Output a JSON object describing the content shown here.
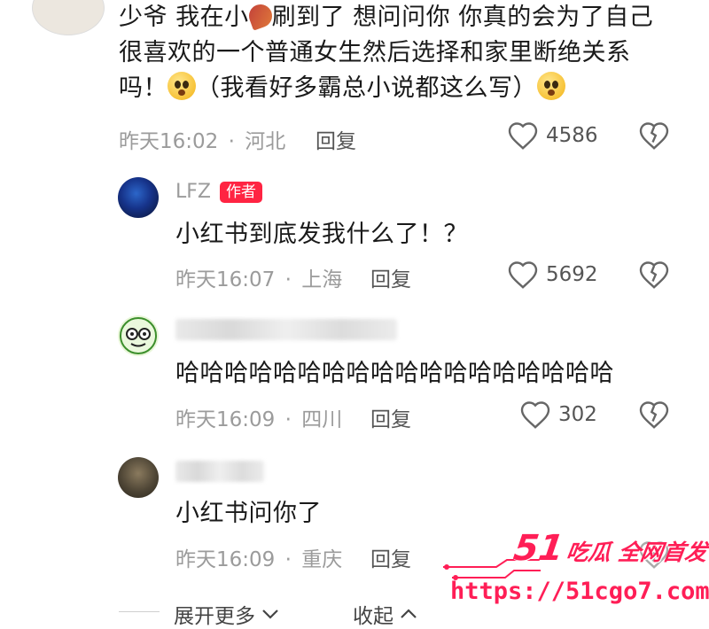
{
  "top_comment": {
    "text_line1": "少爷 我在小",
    "text_line1b": "刷到了 想问问你 你真的会为了自己",
    "text_line2": "很喜欢的一个普通女生然后选择和家里断绝关系",
    "text_line3a": "吗！",
    "text_line3b": "（我看好多霸总小说都这么写）",
    "time": "昨天16:02",
    "location": "河北",
    "reply_label": "回复",
    "likes": "4586"
  },
  "replies": [
    {
      "name": "LFZ",
      "tag": "作者",
      "text": "小红书到底发我什么了！？",
      "time": "昨天16:07",
      "location": "上海",
      "reply_label": "回复",
      "likes": "5692"
    },
    {
      "name": "",
      "text": "哈哈哈哈哈哈哈哈哈哈哈哈哈哈哈哈哈哈",
      "time": "昨天16:09",
      "location": "四川",
      "reply_label": "回复",
      "likes": "302"
    },
    {
      "name": "",
      "text": "小红书问你了",
      "time": "昨天16:09",
      "location": "重庆",
      "reply_label": "回复",
      "likes": ""
    }
  ],
  "footer": {
    "expand_label": "展开更多",
    "collapse_label": "收起"
  },
  "watermark": {
    "brand_num": "51",
    "brand_text": "吃瓜 全网首发",
    "url": "https://51cgo7.com"
  },
  "separator": "·",
  "colors": {
    "accent": "#ff2442",
    "watermark": "#ff1e56"
  }
}
